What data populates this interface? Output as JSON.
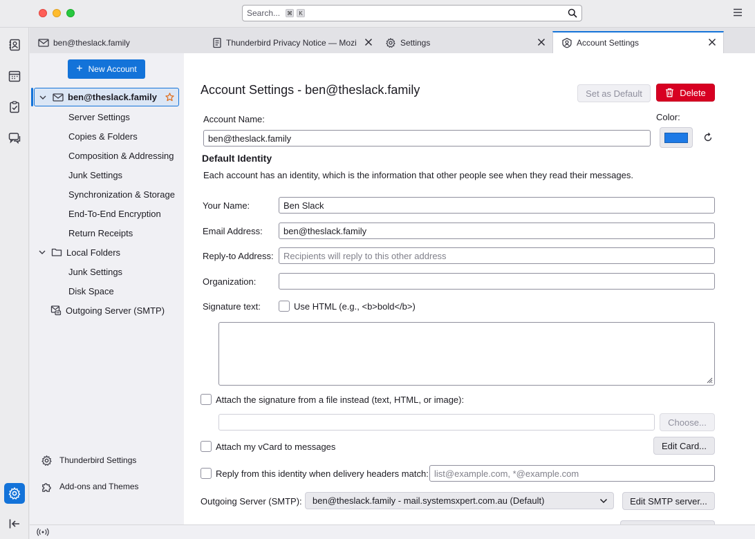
{
  "titlebar": {
    "search_placeholder": "Search...",
    "shortcut_cmd": "⌘",
    "shortcut_key": "K"
  },
  "tabs": [
    {
      "label": "ben@theslack.family",
      "icon": "mail-icon"
    },
    {
      "label": "Thunderbird Privacy Notice — Mozilla",
      "icon": "document-icon"
    },
    {
      "label": "Settings",
      "icon": "gear-icon"
    },
    {
      "label": "Account Settings",
      "icon": "account-icon",
      "active": true
    }
  ],
  "sidebar": {
    "new_account_label": "New Account",
    "account_label": "ben@theslack.family",
    "account_items": [
      "Server Settings",
      "Copies & Folders",
      "Composition & Addressing",
      "Junk Settings",
      "Synchronization & Storage",
      "End-To-End Encryption",
      "Return Receipts"
    ],
    "local_folders_label": "Local Folders",
    "local_items": [
      "Junk Settings",
      "Disk Space"
    ],
    "smtp_label": "Outgoing Server (SMTP)",
    "footer": {
      "thunderbird_settings": "Thunderbird Settings",
      "addons_themes": "Add-ons and Themes"
    }
  },
  "main": {
    "title": "Account Settings - ben@theslack.family",
    "set_default_label": "Set as Default",
    "delete_label": "Delete",
    "account_name_label": "Account Name:",
    "account_name_value": "ben@theslack.family",
    "color_label": "Color:",
    "account_color": "#1e7ae6",
    "default_identity_heading": "Default Identity",
    "identity_description": "Each account has an identity, which is the information that other people see when they read their messages.",
    "your_name_label": "Your Name:",
    "your_name_value": "Ben Slack",
    "email_label": "Email Address:",
    "email_value": "ben@theslack.family",
    "reply_to_label": "Reply-to Address:",
    "reply_to_placeholder": "Recipients will reply to this other address",
    "organization_label": "Organization:",
    "signature_label": "Signature text:",
    "use_html_label": "Use HTML (e.g., <b>bold</b>)",
    "attach_signature_label": "Attach the signature from a file instead (text, HTML, or image):",
    "choose_label": "Choose...",
    "attach_vcard_label": "Attach my vCard to messages",
    "edit_card_label": "Edit Card...",
    "reply_from_label": "Reply from this identity when delivery headers match:",
    "reply_from_placeholder": "list@example.com, *@example.com",
    "outgoing_server_label": "Outgoing Server (SMTP):",
    "outgoing_server_value": "ben@theslack.family - mail.systemsxpert.com.au (Default)",
    "edit_smtp_label": "Edit SMTP server..."
  },
  "colors": {
    "accent": "#1373d9",
    "danger": "#d70022"
  }
}
